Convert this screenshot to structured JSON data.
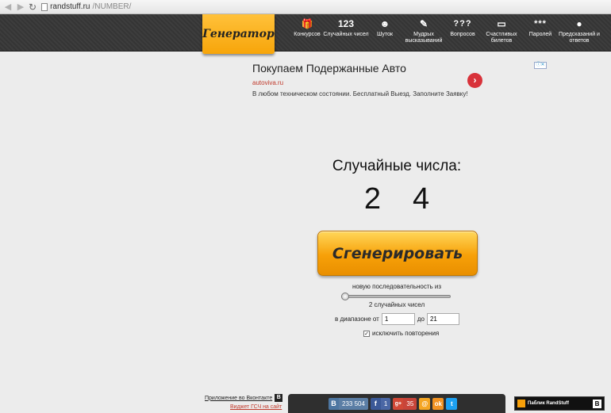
{
  "browser": {
    "url_host": "randstuff.ru",
    "url_path": "/NUMBER/"
  },
  "header": {
    "logo": "Генератор",
    "nav": [
      {
        "icon": "gift-icon",
        "glyph": "🎁",
        "label": "Конкурсов"
      },
      {
        "icon": "number-icon",
        "glyph": "123",
        "label": "Случайных чисел"
      },
      {
        "icon": "smiley-icon",
        "glyph": "☻",
        "label": "Шуток"
      },
      {
        "icon": "notepad-icon",
        "glyph": "✎",
        "label": "Мудрых высказываний"
      },
      {
        "icon": "question-icon",
        "glyph": "???",
        "label": "Вопросов"
      },
      {
        "icon": "ticket-icon",
        "glyph": "▭",
        "label": "Счастливых билетов"
      },
      {
        "icon": "password-icon",
        "glyph": "***",
        "label": "Паролей"
      },
      {
        "icon": "ball-icon",
        "glyph": "●",
        "label": "Предсказаний и ответов"
      }
    ]
  },
  "ad": {
    "title": "Покупаем Подержанные Авто",
    "domain": "autoviva.ru",
    "text": "В любом техническом состоянии. Бесплатный Выезд. Заполните Заявку!",
    "info": "ⓘ✕"
  },
  "main": {
    "title": "Случайные числа:",
    "numbers": [
      "2",
      "4"
    ],
    "generate_button": "Сгенерировать",
    "sequence_label": "новую последовательность из",
    "slider_value": 0,
    "count_label": "2 случайных чисел",
    "range_from_label": "в диапазоне от",
    "range_from_value": "1",
    "range_to_label": "до",
    "range_to_value": "21",
    "exclude_label": "исключить повторения",
    "exclude_checked": true
  },
  "footer": {
    "vk_app": "Приложение во Вконтакте",
    "vk_badge": "В",
    "widget_link": "Виджет ГСЧ на сайт",
    "social": {
      "vk_count": "233 504",
      "fb_count": "1",
      "gp_count": "35"
    },
    "public_label": "Паблик RandStuff",
    "public_badge": "В"
  }
}
